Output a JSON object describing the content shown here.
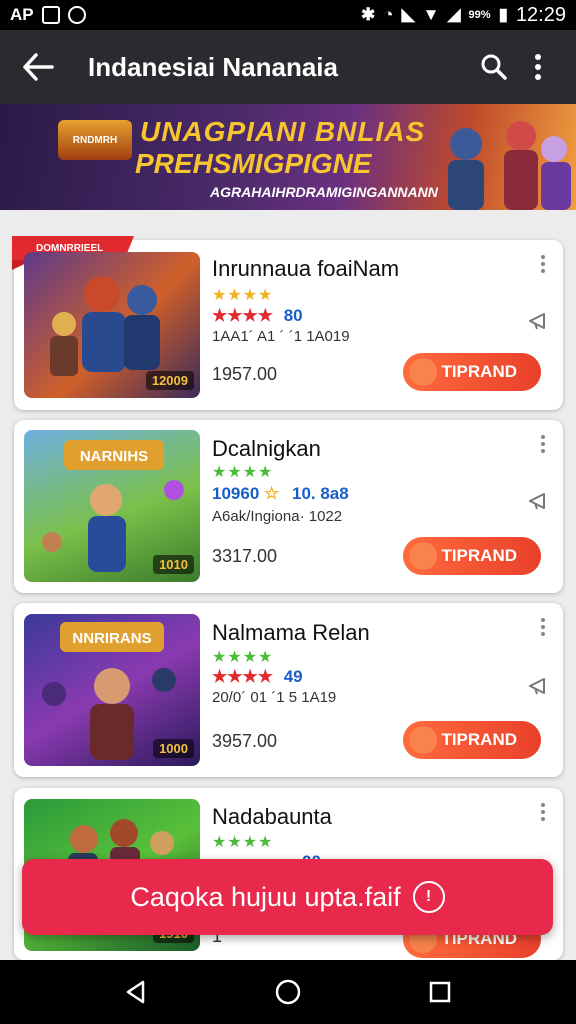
{
  "status_bar": {
    "left_text": "AP",
    "battery_text": "99%",
    "time": "12:29"
  },
  "app_bar": {
    "title": "Indanesiai Nananaia",
    "back_icon": "arrow-left-icon",
    "search_icon": "search-icon",
    "more_icon": "more-vert-icon"
  },
  "banner": {
    "logo_text": "RNDMRH",
    "headline_1": "UNAGPIANI BNLIAS",
    "headline_2": "PREHSMIGPIGNE",
    "subtitle": "AGRAHAIHRDRAMIGINGANNANN"
  },
  "ribbon": {
    "text": "DOMNRRIEEL",
    "corner": "8"
  },
  "cards": [
    {
      "title": "Inrunnaua foaiNam",
      "stars": "★★★★",
      "rating_stars": "★★★★",
      "rating_value": "80",
      "meta": "1AA1´ A1 ´ ´1 1A019",
      "price": "1957.00",
      "badge": "12009",
      "button": "TIPRAND"
    },
    {
      "title": "Dcalnigkan",
      "stars": "★★★★",
      "rating_prefix": "10960",
      "rating_value": "10. 8a8",
      "meta": "A6ak/Ingiona· 1022",
      "price": "3317.00",
      "badge": "1010",
      "button": "TIPRAND",
      "thumb_logo": "NARNIHS"
    },
    {
      "title": "Nalmama Relan",
      "stars": "★★★★",
      "rating_stars": "★★★★",
      "rating_value": "49",
      "meta": "20/0´ 01 ´1 5 1A19",
      "price": "3957.00",
      "badge": "1000",
      "button": "TIPRAND",
      "thumb_logo": "NNRIRANS"
    },
    {
      "title": "Nadabaunta",
      "stars": "★★★★",
      "rating_value": "00",
      "price": "1",
      "badge": "1910",
      "button": "TIPRAND"
    }
  ],
  "toast": {
    "text": "Caqoka hujuu upta.faif",
    "icon": "info-icon"
  },
  "nav": {
    "back_icon": "nav-back-icon",
    "home_icon": "nav-home-icon",
    "recents_icon": "nav-recents-icon"
  },
  "colors": {
    "accent_red": "#e8294b",
    "cta_orange": "#ff6b3d",
    "appbar": "#2a2b2f"
  }
}
